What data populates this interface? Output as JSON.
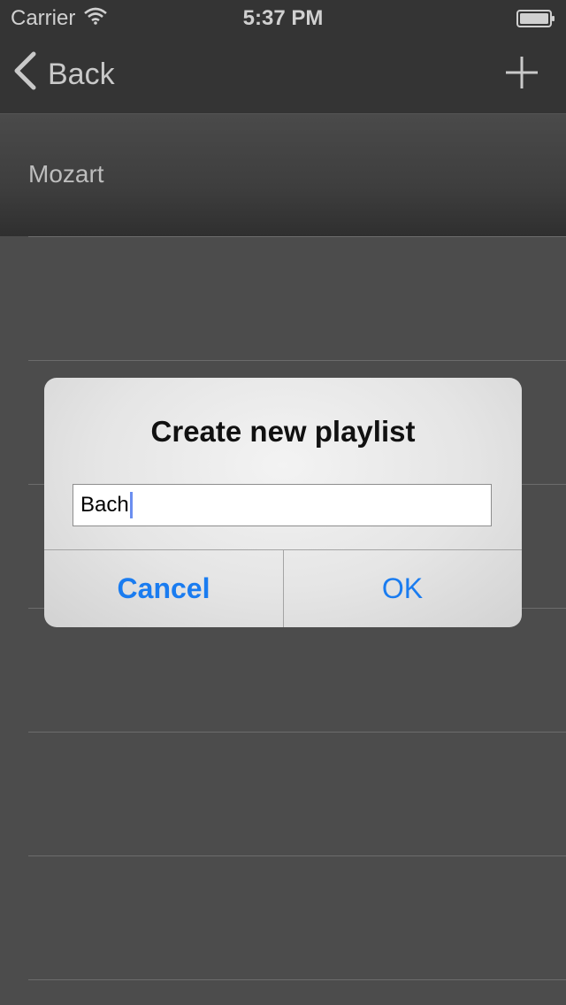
{
  "status_bar": {
    "carrier": "Carrier",
    "time": "5:37 PM"
  },
  "nav": {
    "back_label": "Back",
    "add_icon": "plus-icon"
  },
  "list": {
    "first_item": "Mozart"
  },
  "alert": {
    "title": "Create new playlist",
    "input_value": "Bach",
    "cancel_label": "Cancel",
    "ok_label": "OK"
  },
  "colors": {
    "background": "#4c4c4c",
    "nav_bar": "#343434",
    "accent": "#1a7cf0"
  }
}
